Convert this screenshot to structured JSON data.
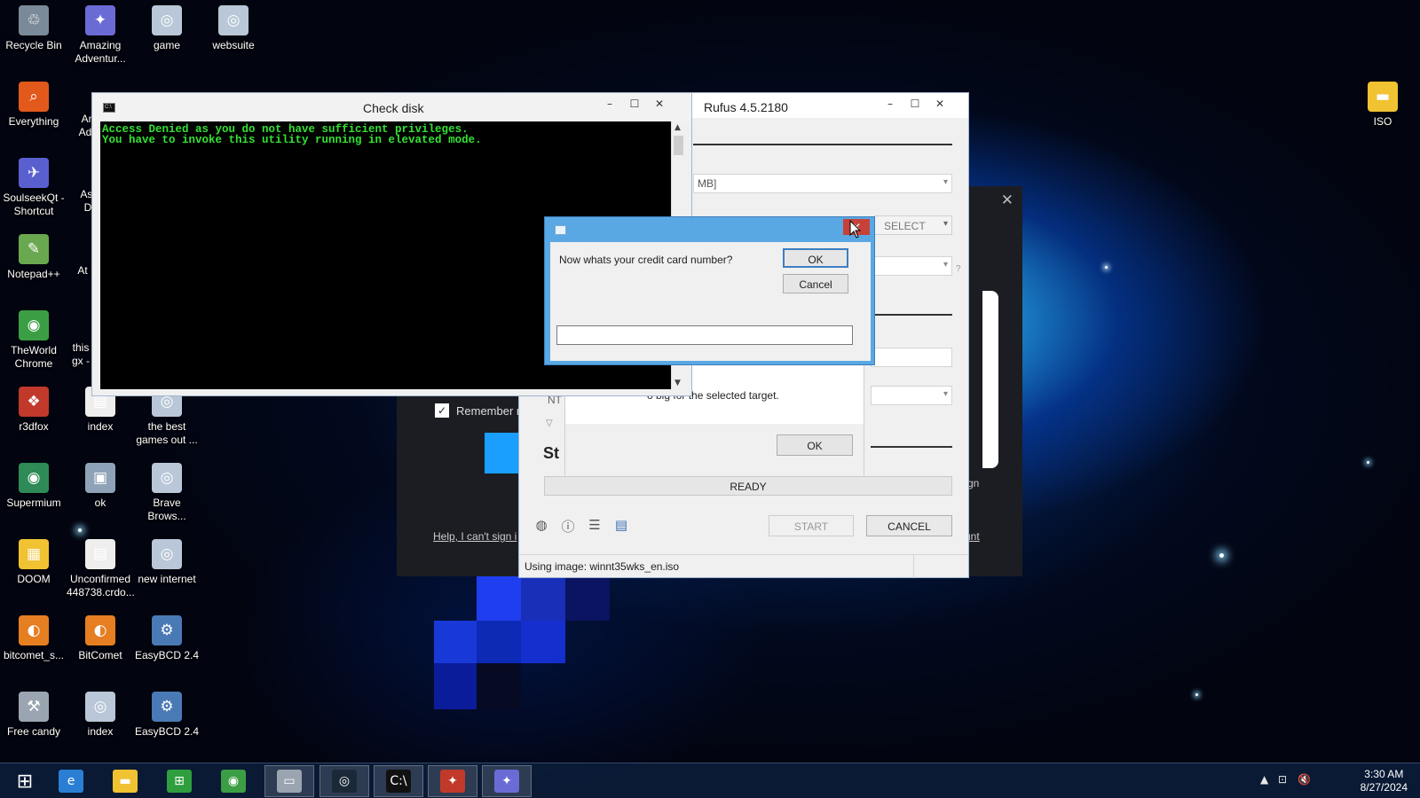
{
  "desktop_icons": [
    {
      "label": "Recycle Bin",
      "icon": "recycle-bin-icon",
      "color": "#7a8a99"
    },
    {
      "label": "Amazing Adventur...",
      "icon": "app-icon",
      "color": "#6b6bd6"
    },
    {
      "label": "game",
      "icon": "web-shortcut-icon",
      "color": "#b9c7d8"
    },
    {
      "label": "websuite",
      "icon": "web-shortcut-icon",
      "color": "#b9c7d8"
    },
    {
      "label": "Everything",
      "icon": "everything-search-icon",
      "color": "#e2591b"
    },
    {
      "label": "SoulseekQt - Shortcut",
      "icon": "soulseek-icon",
      "color": "#5a5fd0"
    },
    {
      "label": "Notepad++",
      "icon": "notepad-plus-icon",
      "color": "#6aa84f"
    },
    {
      "label": "TheWorld Chrome",
      "icon": "browser-icon",
      "color": "#3c9e44"
    },
    {
      "label": "r3dfox",
      "icon": "r3dfox-icon",
      "color": "#c0392b"
    },
    {
      "label": "index",
      "icon": "document-icon",
      "color": "#eeeeee"
    },
    {
      "label": "the best games out ...",
      "icon": "web-shortcut-icon",
      "color": "#b9c7d8"
    },
    {
      "label": "Supermium",
      "icon": "supermium-icon",
      "color": "#2e8b57"
    },
    {
      "label": "ok",
      "icon": "image-icon",
      "color": "#8fa3b8"
    },
    {
      "label": "Brave Brows...",
      "icon": "web-shortcut-icon",
      "color": "#b9c7d8"
    },
    {
      "label": "DOOM",
      "icon": "zip-folder-icon",
      "color": "#f1c232"
    },
    {
      "label": "Unconfirmed 448738.crdo...",
      "icon": "document-icon",
      "color": "#eeeeee"
    },
    {
      "label": "new internet",
      "icon": "web-shortcut-icon",
      "color": "#b9c7d8"
    },
    {
      "label": "bitcomet_s...",
      "icon": "bitcomet-icon",
      "color": "#e67e22"
    },
    {
      "label": "BitComet",
      "icon": "bitcomet-icon",
      "color": "#e67e22"
    },
    {
      "label": "EasyBCD 2.4",
      "icon": "easybcd-icon",
      "color": "#4a7ab5"
    },
    {
      "label": "Free candy",
      "icon": "setup-icon",
      "color": "#9aa5b1"
    },
    {
      "label": "index",
      "icon": "web-shortcut-icon",
      "color": "#b9c7d8"
    },
    {
      "label": "EasyBCD 2.4",
      "icon": "easybcd-icon",
      "color": "#4a7ab5"
    },
    {
      "label": "ISO",
      "icon": "folder-icon",
      "color": "#f1c232"
    }
  ],
  "partial_icon_labels": [
    "An Adv",
    "Ast D",
    "At D",
    "this gx -"
  ],
  "checkdisk": {
    "title": "Check disk",
    "console_lines": [
      "Access Denied as you do not have sufficient privileges.",
      "You have to invoke this utility running in elevated mode."
    ],
    "console_color": "#33e233"
  },
  "rufus": {
    "title": "Rufus 4.5.2180",
    "device_field": "MB]",
    "select_label": "SELECT",
    "nt_text": "NT",
    "st_text": "St",
    "status_text": "READY",
    "start_label": "START",
    "cancel_label": "CANCEL",
    "statusbar_text": "Using image: winnt35wks_en.iso",
    "qmark": "?"
  },
  "rufus_error": {
    "message": "o big for the selected target.",
    "ok_label": "OK",
    "icon": "error-icon"
  },
  "prompt": {
    "question": "Now whats your credit card number?",
    "ok_label": "OK",
    "cancel_label": "Cancel",
    "answer_value": ""
  },
  "background_dialog": {
    "remember_label": "Remember m",
    "help_link": "Help, I can't sign i",
    "account_link": "unt",
    "sign_text": "gn"
  },
  "taskbar": {
    "items": [
      {
        "name": "start-button",
        "icon": "windows-logo-icon"
      },
      {
        "name": "internet-explorer",
        "icon": "internet-explorer-icon",
        "color": "#2a7fd4"
      },
      {
        "name": "file-explorer",
        "icon": "folder-icon",
        "color": "#f1c232"
      },
      {
        "name": "store",
        "icon": "store-icon",
        "color": "#2e9e3e"
      },
      {
        "name": "browser",
        "icon": "browser-icon",
        "color": "#3c9e44"
      },
      {
        "name": "rufus",
        "icon": "usb-drive-icon",
        "color": "#9aa5b1"
      },
      {
        "name": "steam",
        "icon": "steam-icon",
        "color": "#1b2838"
      },
      {
        "name": "command-prompt",
        "icon": "cmd-icon",
        "color": "#111111"
      },
      {
        "name": "app-colorful",
        "icon": "app-icon",
        "color": "#c0392b"
      },
      {
        "name": "app-faded",
        "icon": "app-icon",
        "color": "#6b6bd6"
      }
    ],
    "time": "3:30 AM",
    "date": "8/27/2024"
  }
}
